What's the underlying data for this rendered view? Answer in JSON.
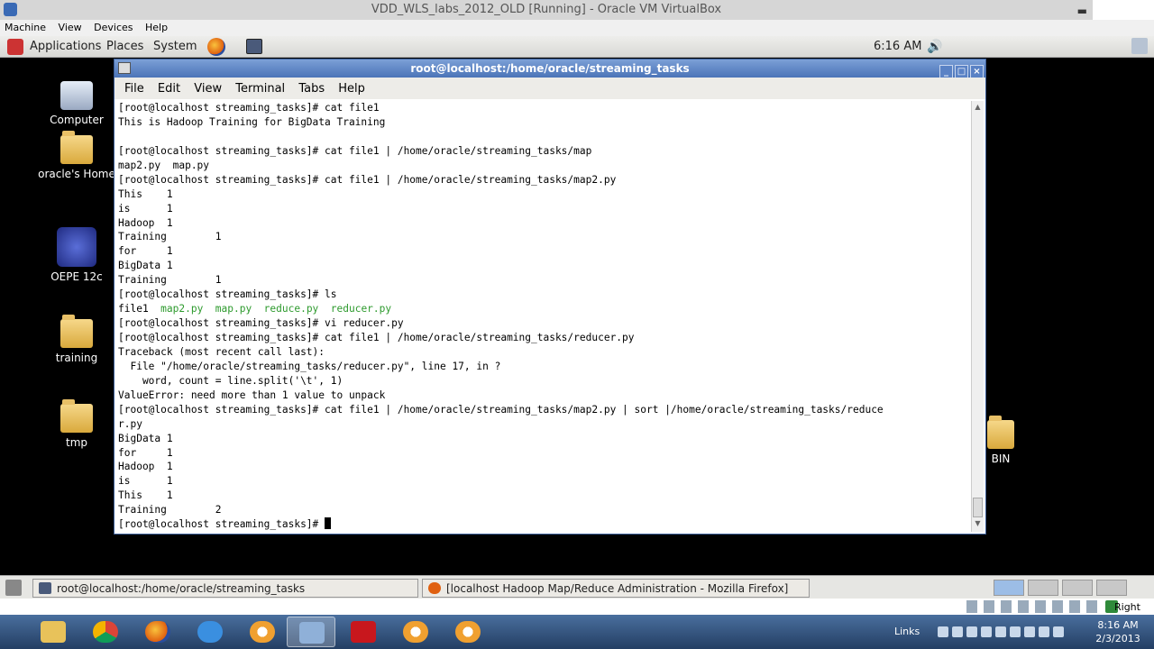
{
  "host_window": {
    "title": "VDD_WLS_labs_2012_OLD [Running] - Oracle VM VirtualBox",
    "minimize_glyph": "▬"
  },
  "vm_menu": [
    "Machine",
    "View",
    "Devices",
    "Help"
  ],
  "top_panel": {
    "applications": "Applications",
    "places": "Places",
    "system": "System",
    "clock": "6:16 AM"
  },
  "desktop_icons": {
    "computer": "Computer",
    "home": "oracle's Home",
    "oepe": "OEPE 12c",
    "training": "training",
    "tmp": "tmp",
    "bin": "BIN"
  },
  "terminal": {
    "title": "root@localhost:/home/oracle/streaming_tasks",
    "menu": [
      "File",
      "Edit",
      "View",
      "Terminal",
      "Tabs",
      "Help"
    ],
    "lines": [
      "[root@localhost streaming_tasks]# cat file1",
      "This is Hadoop Training for BigData Training",
      "",
      "[root@localhost streaming_tasks]# cat file1 | /home/oracle/streaming_tasks/map",
      "map2.py  map.py",
      "[root@localhost streaming_tasks]# cat file1 | /home/oracle/streaming_tasks/map2.py",
      "This\t1",
      "is\t1",
      "Hadoop\t1",
      "Training\t1",
      "for\t1",
      "BigData\t1",
      "Training\t1",
      "[root@localhost streaming_tasks]# ls",
      "file1  map2.py  map.py  reduce.py  reducer.py",
      "[root@localhost streaming_tasks]# vi reducer.py",
      "[root@localhost streaming_tasks]# cat file1 | /home/oracle/streaming_tasks/reducer.py",
      "Traceback (most recent call last):",
      "  File \"/home/oracle/streaming_tasks/reducer.py\", line 17, in ?",
      "    word, count = line.split('\\t', 1)",
      "ValueError: need more than 1 value to unpack",
      "[root@localhost streaming_tasks]# cat file1 | /home/oracle/streaming_tasks/map2.py | sort |/home/oracle/streaming_tasks/reduce",
      "r.py",
      "BigData 1",
      "for\t1",
      "Hadoop\t1",
      "is\t1",
      "This\t1",
      "Training\t2",
      "[root@localhost streaming_tasks]# "
    ],
    "ls_listing": {
      "plain": "file1  ",
      "executables": [
        "map2.py",
        "map.py",
        "reduce.py",
        "reducer.py"
      ]
    },
    "scroll_up_glyph": "▲",
    "scroll_down_glyph": "▼"
  },
  "guest_taskbar": {
    "items": [
      "root@localhost:/home/oracle/streaming_tasks",
      "[localhost Hadoop Map/Reduce Administration - Mozilla Firefox]"
    ],
    "tray_label": "Right Ctrl"
  },
  "win_taskbar": {
    "links": "Links",
    "time": "8:16 AM",
    "date": "2/3/2013"
  },
  "colors": {
    "terminal_executable": "#2d9a2d",
    "title_bar": "#4b74b8",
    "win_taskbar": "#243e63"
  }
}
